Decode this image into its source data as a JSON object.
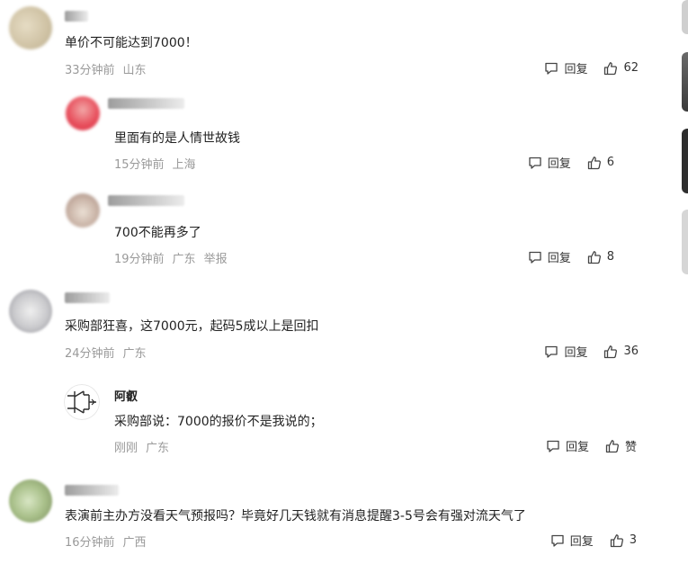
{
  "comments": [
    {
      "text": "单价不可能达到7000！",
      "time": "33分钟前",
      "location": "山东",
      "reply_label": "回复",
      "likes": "62"
    },
    {
      "text": "里面有的是人情世故钱",
      "time": "15分钟前",
      "location": "上海",
      "reply_label": "回复",
      "likes": "6"
    },
    {
      "text": "700不能再多了",
      "time": "19分钟前",
      "location": "广东",
      "report_label": "举报",
      "reply_label": "回复",
      "likes": "8"
    },
    {
      "text": "采购部狂喜，这7000元，起码5成以上是回扣",
      "time": "24分钟前",
      "location": "广东",
      "reply_label": "回复",
      "likes": "36"
    },
    {
      "author": "阿叡",
      "text": "采购部说：7000的报价不是我说的；",
      "time": "刚刚",
      "location": "广东",
      "reply_label": "回复",
      "likes": "赞"
    },
    {
      "text": "表演前主办方没看天气预报吗？毕竟好几天钱就有消息提醒3-5号会有强对流天气了",
      "time": "16分钟前",
      "location": "广西",
      "reply_label": "回复",
      "likes": "3"
    }
  ],
  "icons": {
    "reply": "comment-bubble-icon",
    "like": "thumbs-up-icon"
  }
}
